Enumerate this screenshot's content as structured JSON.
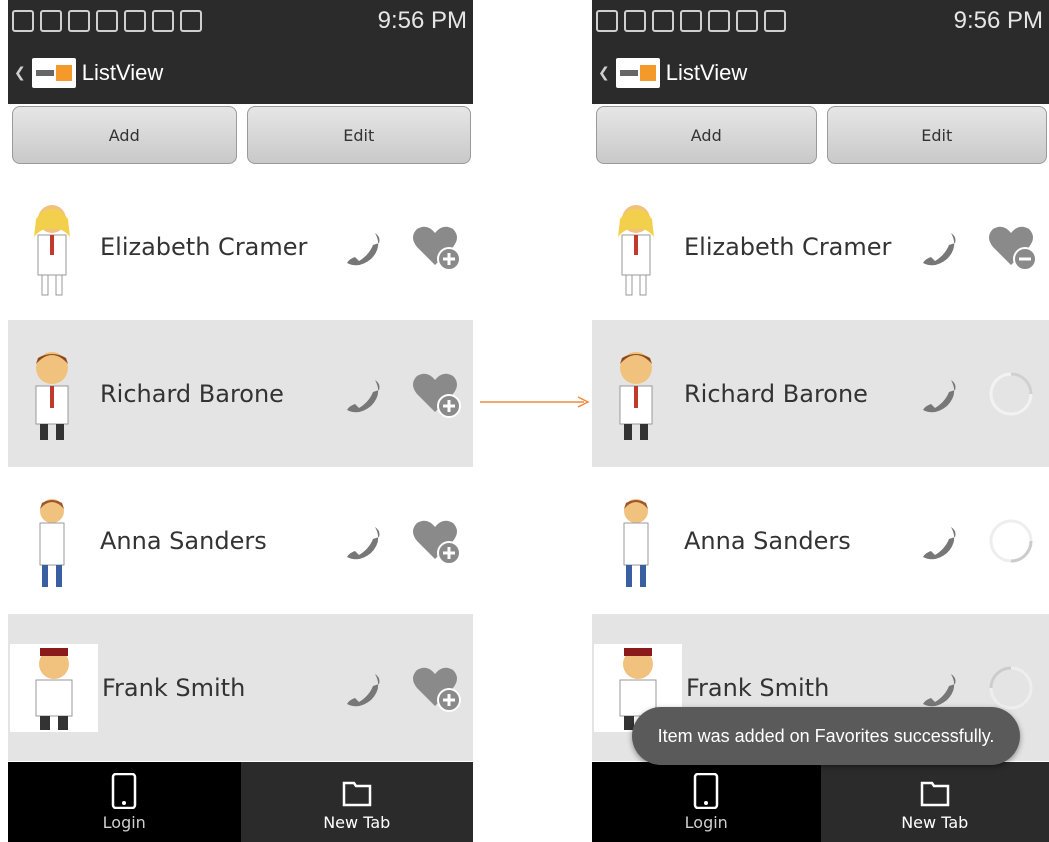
{
  "status": {
    "time": "9:56 PM"
  },
  "actionbar": {
    "title": "ListView"
  },
  "buttons": {
    "add": "Add",
    "edit": "Edit"
  },
  "contacts": [
    {
      "name": "Elizabeth Cramer"
    },
    {
      "name": "Richard Barone"
    },
    {
      "name": "Anna Sanders"
    },
    {
      "name": "Frank Smith"
    }
  ],
  "left_favorites": [
    "heart-plus-icon",
    "heart-plus-icon",
    "heart-plus-icon",
    "heart-plus-icon"
  ],
  "right_favorites": [
    "heart-minus-icon",
    "loading-spinner-icon",
    "loading-spinner-icon",
    "loading-spinner-icon"
  ],
  "tabs": {
    "login": "Login",
    "new_tab": "New Tab"
  },
  "toast": {
    "message": "Item was added on Favorites successfully."
  },
  "colors": {
    "arrow": "#f08a3c",
    "bar": "#2b2b2b",
    "alt_row": "#e4e4e4"
  }
}
